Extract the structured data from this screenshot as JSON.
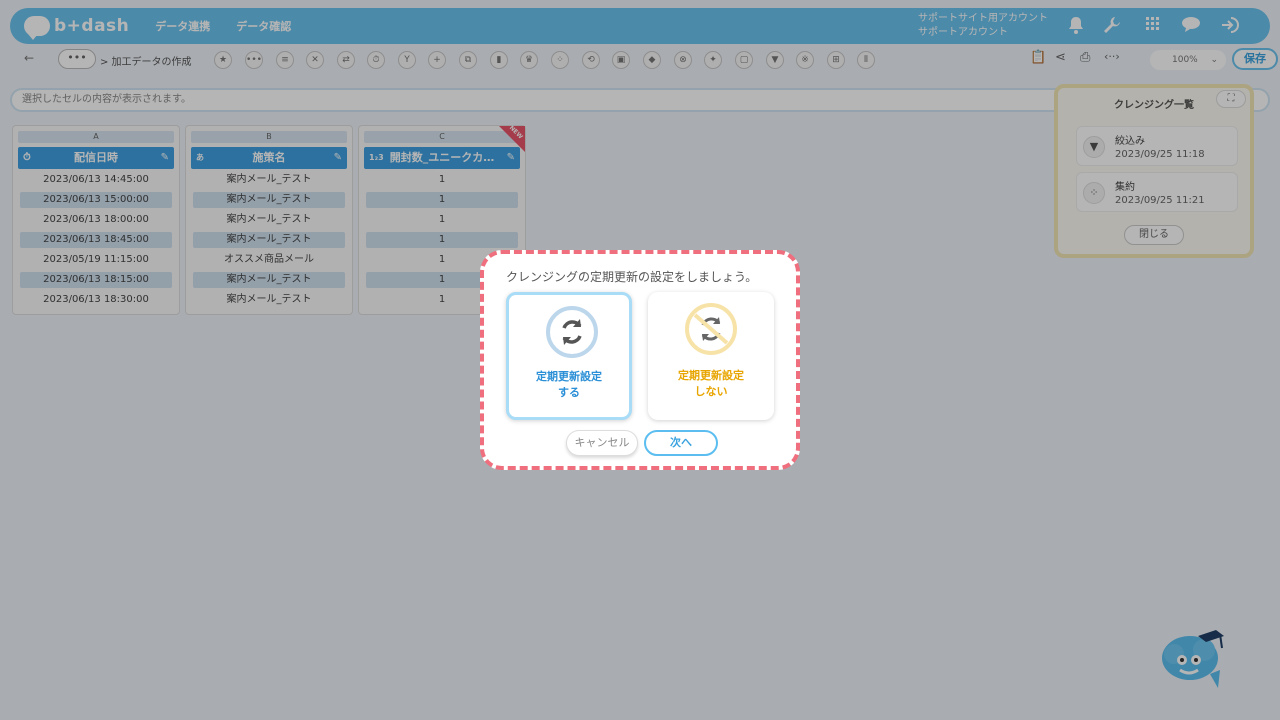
{
  "header": {
    "logo_text": "b+dash",
    "nav": [
      "データ連携",
      "データ確認"
    ],
    "account_line1": "サポートサイト用アカウント",
    "account_line2": "サポートアカウント"
  },
  "toolbar": {
    "back": "←",
    "more": "•••",
    "breadcrumb": "> 加工データの作成",
    "zoom": "100%",
    "save_label": "保存"
  },
  "cell_bar": {
    "placeholder": "選択したセルの内容が表示されます。"
  },
  "columns": [
    {
      "letter": "A",
      "header": "配信日時",
      "type_icon": "⏱",
      "cells": [
        "2023/06/13 14:45:00",
        "2023/06/13 15:00:00",
        "2023/06/13 18:00:00",
        "2023/06/13 18:45:00",
        "2023/05/19 11:15:00",
        "2023/06/13 18:15:00",
        "2023/06/13 18:30:00"
      ]
    },
    {
      "letter": "B",
      "header": "施策名",
      "type_icon": "あ",
      "cells": [
        "案内メール_テスト",
        "案内メール_テスト",
        "案内メール_テスト",
        "案内メール_テスト",
        "オススメ商品メール",
        "案内メール_テスト",
        "案内メール_テスト"
      ]
    },
    {
      "letter": "C",
      "header": "開封数_ユニークカ…",
      "type_icon": "1₂3",
      "new_badge": "NEW",
      "cells": [
        "1",
        "1",
        "1",
        "1",
        "1",
        "1",
        "1"
      ]
    }
  ],
  "side_panel": {
    "title": "クレンジング一覧",
    "items": [
      {
        "name": "絞込み",
        "date": "2023/09/25 11:18"
      },
      {
        "name": "集約",
        "date": "2023/09/25 11:21"
      }
    ],
    "close_label": "閉じる"
  },
  "dialog": {
    "title": "クレンジングの定期更新の設定をしましょう。",
    "option_on_line1": "定期更新設定",
    "option_on_line2": "する",
    "option_off_line1": "定期更新設定",
    "option_off_line2": "しない",
    "cancel_label": "キャンセル",
    "next_label": "次へ"
  },
  "colors": {
    "accent": "#6cc3ef",
    "dialog_border": "#ef6f7e",
    "option_on": "#2a8fd6",
    "option_off": "#e8a500"
  }
}
